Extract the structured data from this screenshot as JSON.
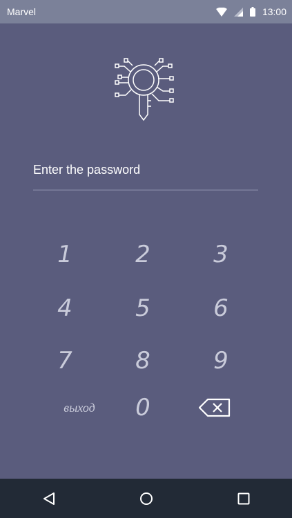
{
  "status_bar": {
    "carrier": "Marvel",
    "time": "13:00",
    "icons": [
      "wifi-icon",
      "signal-icon",
      "battery-icon"
    ]
  },
  "app": {
    "logo_icon": "circuit-key-icon",
    "password_placeholder": "Enter the password",
    "keypad": {
      "digits": [
        "1",
        "2",
        "3",
        "4",
        "5",
        "6",
        "7",
        "8",
        "9"
      ],
      "exit_label": "выход",
      "zero": "0",
      "backspace_icon": "backspace-icon"
    }
  },
  "nav_bar": {
    "icons": [
      "back-icon",
      "home-icon",
      "recents-icon"
    ]
  },
  "colors": {
    "background": "#5a5c7d",
    "status_bar": "#7b8199",
    "nav_bar": "#222a36",
    "key_text": "#c9cbda"
  }
}
